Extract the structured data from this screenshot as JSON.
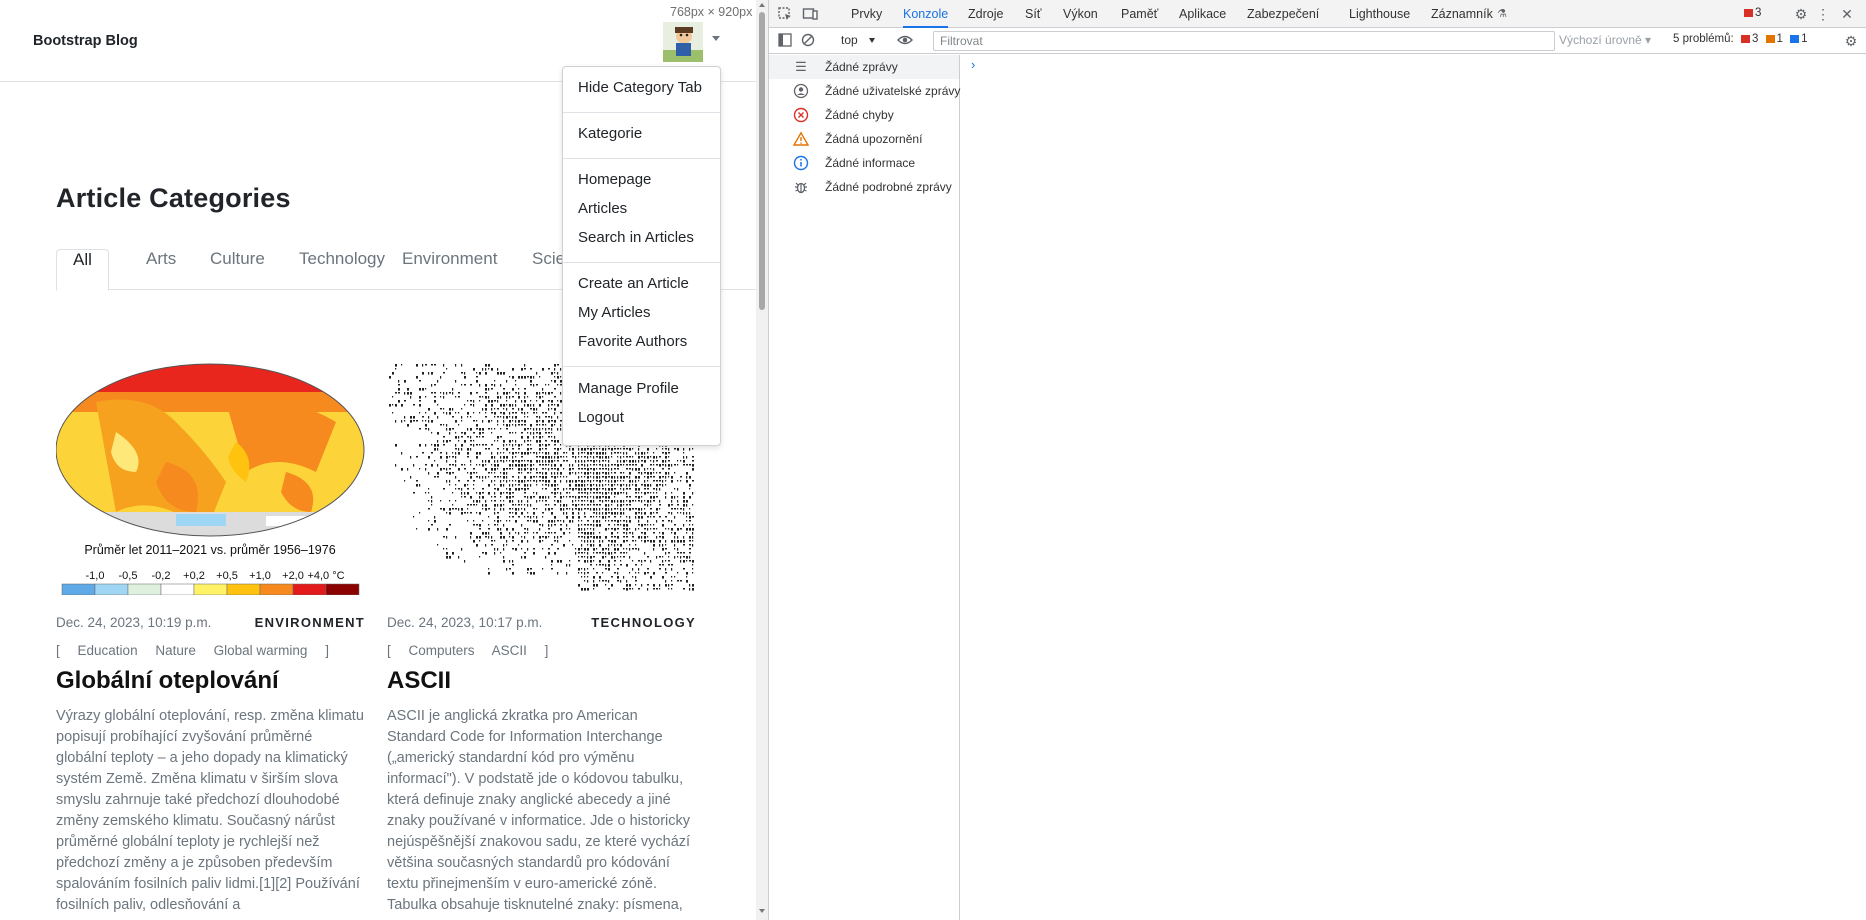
{
  "page": {
    "brand": "Bootstrap Blog",
    "dimensions_overlay": "768px × 920px",
    "title": "Article Categories",
    "tabs": [
      "All",
      "Arts",
      "Culture",
      "Technology",
      "Environment",
      "Scie"
    ],
    "active_tab": "All",
    "dropdown": {
      "items": [
        [
          "Hide Category Tab"
        ],
        [
          "Kategorie"
        ],
        [
          "Homepage",
          "Articles",
          "Search in Articles"
        ],
        [
          "Create an Article",
          "My Articles",
          "Favorite Authors"
        ],
        [
          "Manage Profile",
          "Logout"
        ]
      ]
    },
    "cards": [
      {
        "date": "Dec. 24, 2023, 10:19 p.m.",
        "category": "ENVIRONMENT",
        "tags": [
          "Education",
          "Nature",
          "Global warming"
        ],
        "title": "Globální oteplování",
        "text": "Výrazy globální oteplování, resp. změna klimatu popisují probíhající zvyšování průměrné globální teploty – a jeho dopady na klimatický systém Země. Změna klimatu v širším slova smyslu zahrnuje také předchozí dlouhodobé změny zemského klimatu. Současný nárůst průměrné globální teploty je rychlejší než předchozí změny a je způsoben především spalováním fosilních paliv lidmi.[1][2] Používání fosilních paliv, odlesňování a",
        "image_caption": "Průměr let 2011–2021 vs. průměr 1956–1976",
        "legend": [
          "-1,0",
          "-0,5",
          "-0,2",
          "+0,2",
          "+0,5",
          "+1,0",
          "+2,0",
          "+4,0 °C"
        ],
        "legend_colors": [
          "#5ea9e6",
          "#9fd6f3",
          "#dff0df",
          "#ffffff",
          "#fff266",
          "#ffc20e",
          "#f68a1f",
          "#e31a1c",
          "#8b0000"
        ]
      },
      {
        "date": "Dec. 24, 2023, 10:17 p.m.",
        "category": "TECHNOLOGY",
        "tags": [
          "Computers",
          "ASCII"
        ],
        "title": "ASCII",
        "text": "ASCII je anglická zkratka pro American Standard Code for Information Interchange („americký standardní kód pro výměnu informací\"). V podstatě jde o kódovou tabulku, která definuje znaky anglické abecedy a jiné znaky používané v informatice. Jde o historicky nejúspěšnější znakovou sadu, ze které vychází většina současných standardů pro kódování textu přinejmenším v euro-americké zóně. Tabulka obsahuje tisknutelné znaky: písmena,"
      }
    ]
  },
  "devtools": {
    "tabs": [
      "Prvky",
      "Konzole",
      "Zdroje",
      "Síť",
      "Výkon",
      "Paměť",
      "Aplikace",
      "Zabezpečení",
      "Lighthouse",
      "Záznamník"
    ],
    "active_tab": "Konzole",
    "error_badge_count": "3",
    "context": "top",
    "filter_placeholder": "Filtrovat",
    "levels": "Výchozí úrovně",
    "problems_label": "5 problémů:",
    "problem_counts": {
      "errors": "3",
      "warnings": "1",
      "info": "1"
    },
    "sidebar": [
      {
        "label": "Žádné zprávy",
        "icon": "list-icon"
      },
      {
        "label": "Žádné uživatelské zprávy",
        "icon": "user-icon"
      },
      {
        "label": "Žádné chyby",
        "icon": "error-icon"
      },
      {
        "label": "Žádná upozornění",
        "icon": "warning-icon"
      },
      {
        "label": "Žádné informace",
        "icon": "info-icon"
      },
      {
        "label": "Žádné podrobné zprávy",
        "icon": "bug-icon"
      }
    ],
    "colors": {
      "accent": "#1a73e8",
      "error": "#d93025",
      "warning": "#e37400"
    }
  }
}
